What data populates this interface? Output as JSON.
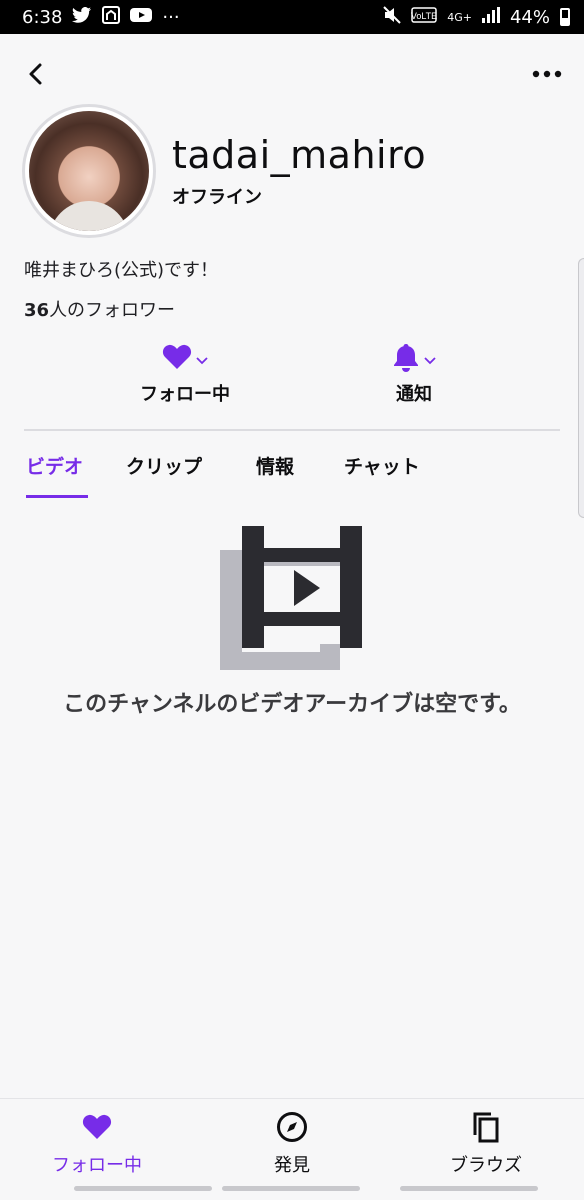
{
  "status_bar": {
    "time": "6:38",
    "dots": "···",
    "network": "4G+",
    "battery": "44%"
  },
  "profile": {
    "username": "tadai_mahiro",
    "status": "オフライン",
    "bio": "唯井まひろ(公式)です！",
    "followers_count": "36",
    "followers_suffix": "人のフォロワー"
  },
  "actions": {
    "follow_label": "フォロー中",
    "notify_label": "通知"
  },
  "tabs": [
    {
      "label": "ビデオ",
      "active": true
    },
    {
      "label": "クリップ",
      "active": false
    },
    {
      "label": "情報",
      "active": false
    },
    {
      "label": "チャット",
      "active": false
    }
  ],
  "empty_state": {
    "message": "このチャンネルのビデオアーカイブは空です。"
  },
  "bottom_nav": [
    {
      "label": "フォロー中",
      "icon": "heart-icon",
      "active": true
    },
    {
      "label": "発見",
      "icon": "compass-icon",
      "active": false
    },
    {
      "label": "ブラウズ",
      "icon": "browse-icon",
      "active": false
    }
  ],
  "colors": {
    "accent": "#772ce8",
    "text": "#0e0e10",
    "background": "#f7f7f8"
  }
}
